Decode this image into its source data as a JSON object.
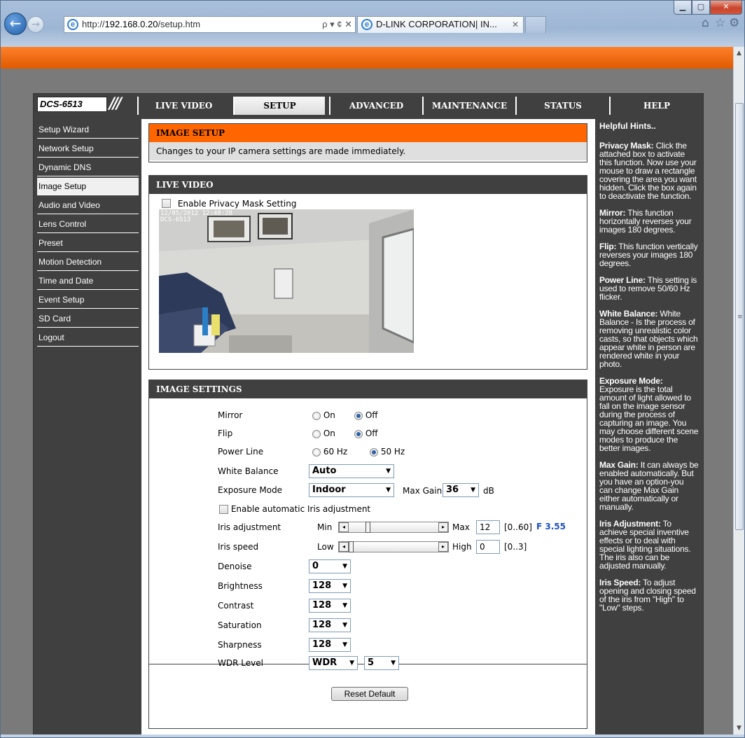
{
  "browser": {
    "url_prefix": "http://",
    "url_host": "192.168.0.20",
    "url_path": "/setup.htm",
    "tab_title": "D-LINK CORPORATION| IN...",
    "search_controls": "ρ ▾ ¢ ✕"
  },
  "camera": {
    "model": "DCS-6513",
    "tabs": [
      "LIVE VIDEO",
      "SETUP",
      "ADVANCED",
      "MAINTENANCE",
      "STATUS",
      "HELP"
    ],
    "active_tab": "SETUP"
  },
  "sidebar": {
    "items": [
      "Setup Wizard",
      "Network Setup",
      "Dynamic DNS",
      "Image Setup",
      "Audio and Video",
      "Lens Control",
      "Preset",
      "Motion Detection",
      "Time and Date",
      "Event Setup",
      "SD Card",
      "Logout"
    ],
    "active": "Image Setup"
  },
  "image_setup": {
    "title": "IMAGE SETUP",
    "description": "Changes to your IP camera settings are made immediately."
  },
  "live_video": {
    "title": "LIVE VIDEO",
    "privacy_mask_label": "Enable Privacy Mask Setting",
    "osd_line1": "12/05/2012 12:48:28",
    "osd_line2": "DCS-6513"
  },
  "settings": {
    "title": "IMAGE SETTINGS",
    "mirror": {
      "label": "Mirror",
      "on": "On",
      "off": "Off",
      "selected": "Off"
    },
    "flip": {
      "label": "Flip",
      "on": "On",
      "off": "Off",
      "selected": "Off"
    },
    "power_line": {
      "label": "Power Line",
      "opt1": "60 Hz",
      "opt2": "50 Hz",
      "selected": "50 Hz"
    },
    "white_balance": {
      "label": "White Balance",
      "value": "Auto"
    },
    "exposure_mode": {
      "label": "Exposure Mode",
      "value": "Indoor",
      "max_gain_label": "Max Gain",
      "max_gain_value": "36",
      "unit": "dB"
    },
    "auto_iris_label": "Enable automatic Iris adjustment",
    "iris_adjustment": {
      "label": "Iris adjustment",
      "min_label": "Min",
      "max_label": "Max",
      "value": "12",
      "range": "[0..60]",
      "fnumber": "F 3.55",
      "level": 0.2
    },
    "iris_speed": {
      "label": "Iris speed",
      "low_label": "Low",
      "high_label": "High",
      "value": "0",
      "range": "[0..3]",
      "level": 0
    },
    "denoise": {
      "label": "Denoise",
      "value": "0"
    },
    "brightness": {
      "label": "Brightness",
      "value": "128"
    },
    "contrast": {
      "label": "Contrast",
      "value": "128"
    },
    "saturation": {
      "label": "Saturation",
      "value": "128"
    },
    "sharpness": {
      "label": "Sharpness",
      "value": "128"
    },
    "wdr": {
      "label": "WDR Level",
      "mode": "WDR",
      "level": "5"
    },
    "reset_label": "Reset Default"
  },
  "hints": {
    "title": "Helpful Hints..",
    "items": [
      {
        "term": "Privacy Mask:",
        "text": "Click the attached box to activate this function. Now use your mouse to draw a rectangle covering the area you want hidden. Click the box again to deactivate the function."
      },
      {
        "term": "Mirror:",
        "text": "This function horizontally reverses your images 180 degrees."
      },
      {
        "term": "Flip:",
        "text": "This function vertically reverses your images 180 degrees."
      },
      {
        "term": "Power Line:",
        "text": "This setting is used to remove 50/60 Hz flicker."
      },
      {
        "term": "White Balance:",
        "text": "White Balance - Is the process of removing unrealistic color casts, so that objects which appear white in person are rendered white in your photo."
      },
      {
        "term": "Exposure Mode:",
        "text": "Exposure is the total amount of light allowed to fall on the image sensor during the process of capturing an image. You may choose different scene modes to produce the better images."
      },
      {
        "term": "Max Gain:",
        "text": "It can always be enabled automatically. But you have an option-you can change Max Gain either automatically or manually."
      },
      {
        "term": "Iris Adjustment:",
        "text": "To achieve special inventive effects or to deal with special lighting situations. The iris also can be adjusted manually."
      },
      {
        "term": "Iris Speed:",
        "text": "To adjust opening and closing speed of the iris from \"High\" to \"Low\" steps."
      }
    ]
  },
  "colors": {
    "orange": "#ff6600",
    "dark": "#404040",
    "accent_blue": "#1f4fbf"
  }
}
